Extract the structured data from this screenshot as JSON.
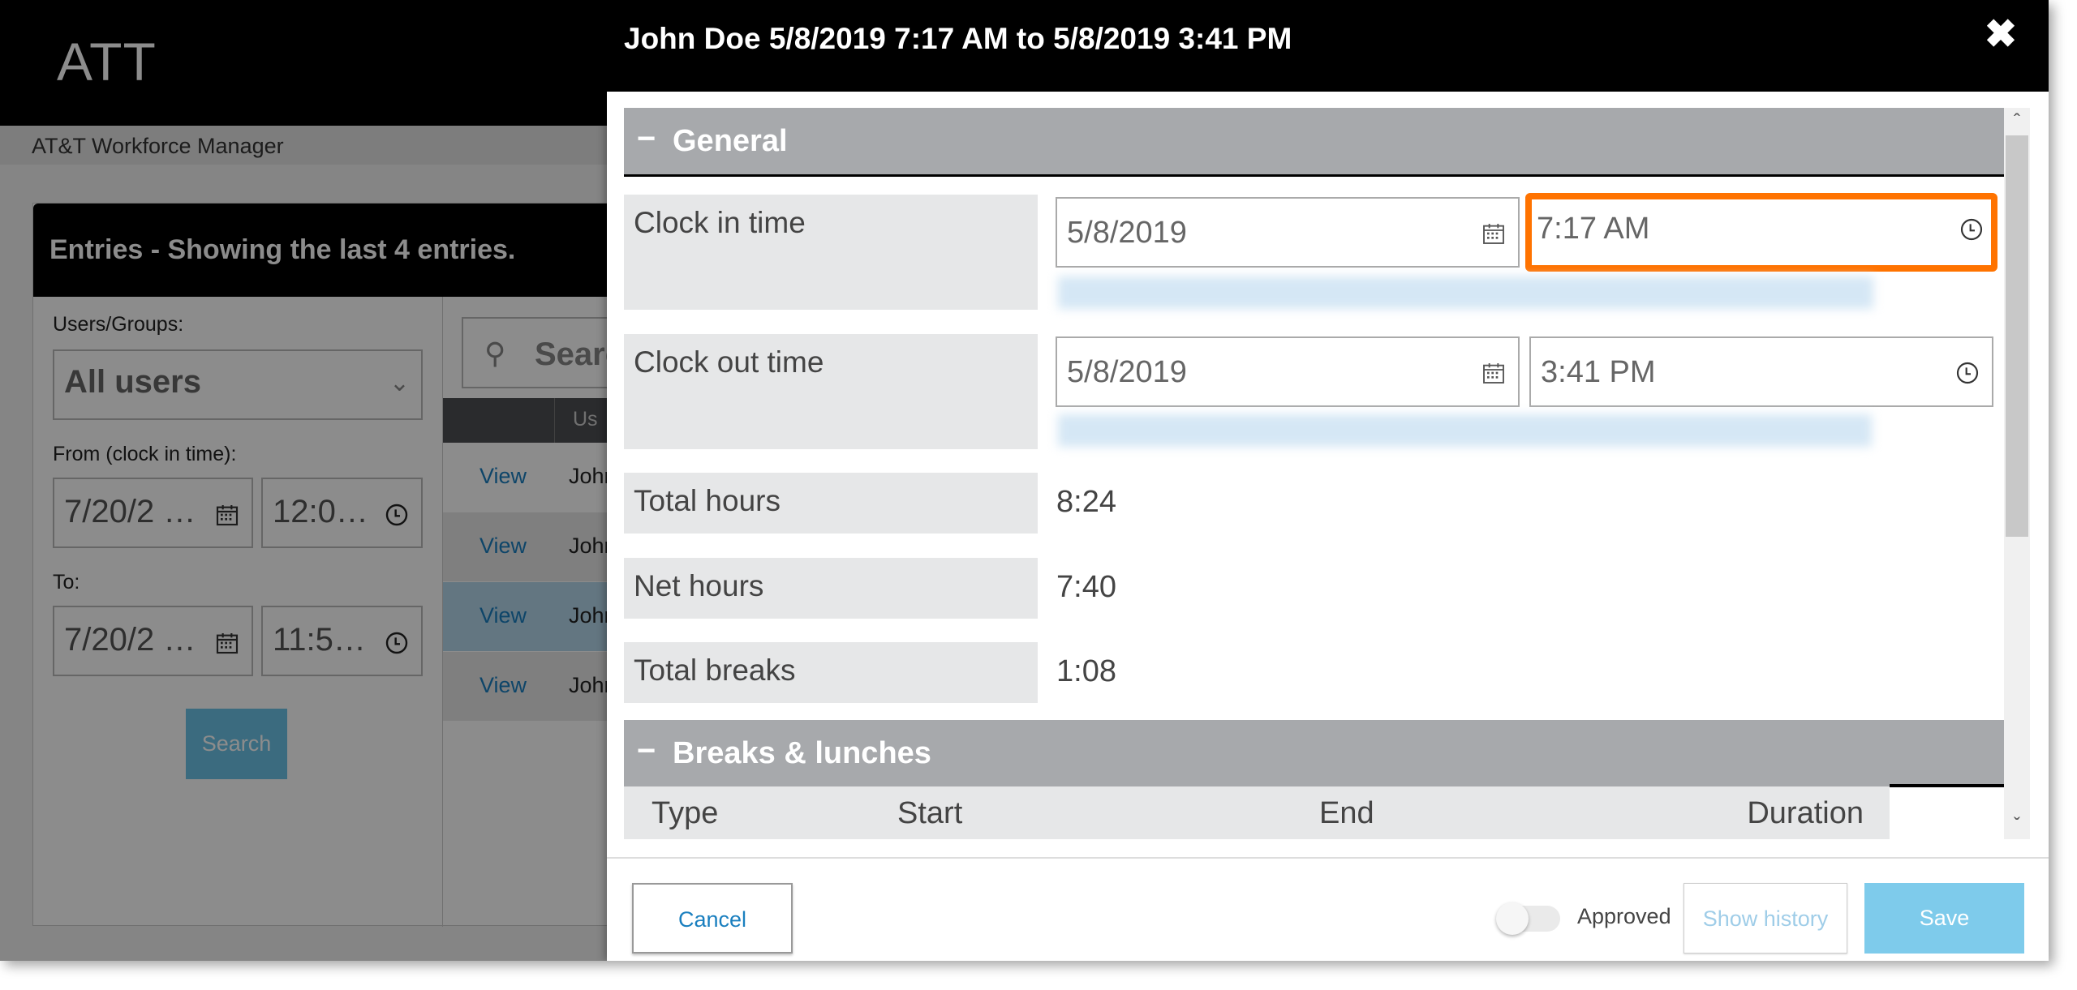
{
  "app": {
    "logo": "ATT",
    "subtitle": "AT&T Workforce Manager"
  },
  "entries": {
    "title": "Entries - Showing the last 4 entries.",
    "filters": {
      "users_label": "Users/Groups:",
      "users_value": "All users",
      "from_label": "From (clock in time):",
      "from_date": "7/20/2 …",
      "from_time": "12:0…",
      "to_label": "To:",
      "to_date": "7/20/2 …",
      "to_time": "11:5…",
      "search_button": "Search"
    },
    "results": {
      "search_placeholder": "Search",
      "column_user": "Us",
      "rows": [
        {
          "action": "View",
          "name": "John"
        },
        {
          "action": "View",
          "name": "John"
        },
        {
          "action": "View",
          "name": "John"
        },
        {
          "action": "View",
          "name": "John"
        }
      ],
      "selected_row_index": 2
    }
  },
  "dialog": {
    "title": "John Doe 5/8/2019 7:17 AM to 5/8/2019 3:41 PM",
    "close_icon": "close-icon",
    "general": {
      "toggle": "−",
      "title": "General",
      "clock_in_label": "Clock in time",
      "clock_in_date": "5/8/2019",
      "clock_in_time": "7:17 AM",
      "clock_out_label": "Clock out time",
      "clock_out_date": "5/8/2019",
      "clock_out_time": "3:41 PM",
      "total_hours_label": "Total hours",
      "total_hours": "8:24",
      "net_hours_label": "Net hours",
      "net_hours": "7:40",
      "total_breaks_label": "Total breaks",
      "total_breaks": "1:08"
    },
    "breaks": {
      "toggle": "−",
      "title": "Breaks & lunches",
      "columns": [
        "Type",
        "Start",
        "End",
        "Duration"
      ]
    },
    "footer": {
      "cancel": "Cancel",
      "approved_label": "Approved",
      "approved": false,
      "show_history": "Show history",
      "save": "Save"
    }
  },
  "colors": {
    "focus_outline": "#ff7300",
    "section_bar": "#a7a9ac",
    "primary_button": "#7ecbeb",
    "link": "#1a7fbf"
  }
}
